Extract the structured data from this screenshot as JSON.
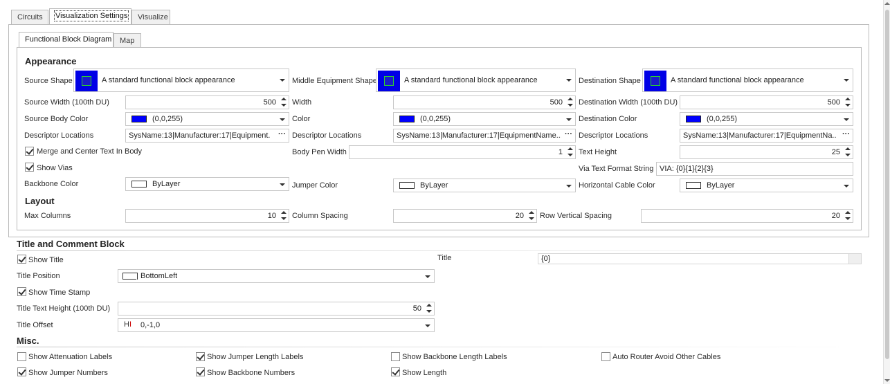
{
  "top_tabs": [
    "Circuits",
    "Visualization Settings",
    "Visualize"
  ],
  "inner_tabs": [
    "Functional Block Diagram",
    "Map"
  ],
  "appearance": {
    "header": "Appearance",
    "source_shape_label": "Source Shape",
    "source_shape_value": "A standard functional block appearance",
    "middle_shape_label": "Middle Equipment Shape",
    "middle_shape_value": "A standard functional block appearance",
    "dest_shape_label": "Destination Shape",
    "dest_shape_value": "A standard functional block appearance",
    "source_width_label": "Source Width (100th DU)",
    "source_width_value": "500",
    "width_label": "Width",
    "width_value": "500",
    "dest_width_label": "Destination Width (100th DU)",
    "dest_width_value": "500",
    "source_body_color_label": "Source Body Color",
    "source_body_color_value": "(0,0,255)",
    "color_label": "Color",
    "color_value": "(0,0,255)",
    "dest_color_label": "Destination Color",
    "dest_color_value": "(0,0,255)",
    "descriptor_label_1": "Descriptor Locations",
    "descriptor_value_1": "SysName:13|Manufacturer:17|Equipment...",
    "descriptor_label_2": "Descriptor Locations",
    "descriptor_value_2": "SysName:13|Manufacturer:17|EquipmentName...",
    "descriptor_label_3": "Descriptor Locations",
    "descriptor_value_3": "SysName:13|Manufacturer:17|EquipmentNa...",
    "ellipsis": "···",
    "merge_center_label": "Merge and Center Text In Body",
    "merge_center_checked": true,
    "body_pen_width_label": "Body Pen Width",
    "body_pen_width_value": "1",
    "text_height_label": "Text Height",
    "text_height_value": "25",
    "show_vias_label": "Show Vias",
    "show_vias_checked": true,
    "via_text_format_label": "Via Text Format String",
    "via_text_format_value": "VIA: {0}{1}{2}{3}",
    "backbone_color_label": "Backbone Color",
    "backbone_color_value": "ByLayer",
    "jumper_color_label": "Jumper Color",
    "jumper_color_value": "ByLayer",
    "horizontal_cable_color_label": "Horizontal Cable Color",
    "horizontal_cable_color_value": "ByLayer",
    "blue_color": "#0000ff"
  },
  "layout": {
    "header": "Layout",
    "max_columns_label": "Max Columns",
    "max_columns_value": "10",
    "column_spacing_label": "Column Spacing",
    "column_spacing_value": "20",
    "row_spacing_label": "Row Vertical Spacing",
    "row_spacing_value": "20"
  },
  "title_block": {
    "header": "Title and Comment Block",
    "show_title_label": "Show Title",
    "show_title_checked": true,
    "title_label": "Title",
    "title_value": "{0}",
    "title_position_label": "Title Position",
    "title_position_value": "BottomLeft",
    "show_time_stamp_label": "Show Time Stamp",
    "show_time_stamp_checked": true,
    "title_text_height_label": "Title Text Height (100th DU)",
    "title_text_height_value": "50",
    "title_offset_label": "Title Offset",
    "title_offset_value": "0,-1,0"
  },
  "misc": {
    "header": "Misc.",
    "show_attenuation_labels": "Show Attenuation Labels",
    "show_attenuation_checked": false,
    "show_jumper_length_labels": "Show Jumper Length Labels",
    "show_jumper_length_checked": true,
    "show_backbone_length_labels": "Show Backbone Length Labels",
    "show_backbone_length_checked": false,
    "auto_router_avoid": "Auto Router Avoid Other Cables",
    "auto_router_avoid_checked": false,
    "show_jumper_numbers": "Show Jumper Numbers",
    "show_jumper_numbers_checked": true,
    "show_backbone_numbers": "Show Backbone Numbers",
    "show_backbone_numbers_checked": true,
    "show_length": "Show Length",
    "show_length_checked": true
  }
}
